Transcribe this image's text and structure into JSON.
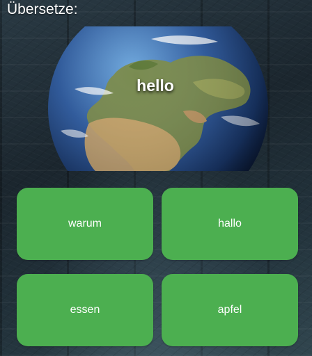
{
  "quiz": {
    "prompt": "Übersetze:",
    "word": "hello",
    "answers": [
      "warum",
      "hallo",
      "essen",
      "apfel"
    ]
  },
  "colors": {
    "button": "#4caf50",
    "text": "#ffffff",
    "ocean": "#2c5aa0"
  },
  "images": {
    "globe": "earth-globe-illustration"
  }
}
